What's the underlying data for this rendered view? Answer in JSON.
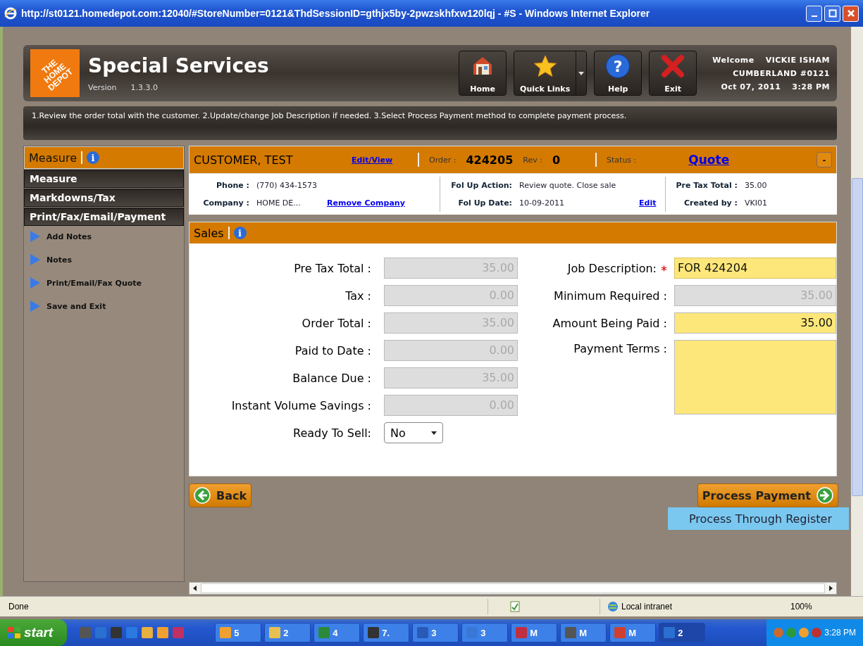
{
  "window": {
    "title": "http://st0121.homedepot.com:12040/#StoreNumber=0121&ThdSessionID=gthjx5by-2pwzskhfxw120lqj - #S - Windows Internet Explorer"
  },
  "header": {
    "logo_text": "THE HOME DEPOT",
    "app_title": "Special Services",
    "version_label": "Version",
    "version": "1.3.3.0",
    "buttons": [
      {
        "kind": "home",
        "label": "Home",
        "has_menu": false
      },
      {
        "kind": "star",
        "label": "Quick Links",
        "has_menu": true
      },
      {
        "kind": "help",
        "label": "Help",
        "glyph": "?",
        "has_menu": false
      },
      {
        "kind": "exit",
        "label": "Exit",
        "has_menu": false
      }
    ],
    "welcome": "Welcome",
    "user": "VICKIE ISHAM",
    "store": "CUMBERLAND #0121",
    "date": "Oct 07, 2011",
    "time": "3:28 PM"
  },
  "instructions": "1.Review the order total with the customer. 2.Update/change Job Description if needed. 3.Select Process Payment method to complete payment process.",
  "sidebar": {
    "title": "Measure",
    "info_icon": "i",
    "sections": [
      "Measure",
      "Markdowns/Tax",
      "Print/Fax/Email/Payment"
    ],
    "actions": [
      "Add Notes",
      "Notes",
      "Print/Email/Fax Quote",
      "Save and Exit"
    ]
  },
  "order": {
    "customer": "CUSTOMER, TEST",
    "edit_link": "Edit/View",
    "order_label": "Order :",
    "order_number": "424205",
    "rev_label": "Rev :",
    "rev": "0",
    "status_label": "Status :",
    "status": "Quote",
    "collapse": "-",
    "details": [
      {
        "label": "Phone :",
        "value": "(770) 434-1573"
      },
      {
        "label": "Fol Up Action:",
        "value": "Review quote. Close sale"
      },
      {
        "label": "Pre Tax Total :",
        "value": "35.00"
      },
      {
        "label": "Company :",
        "value": "HOME DE...",
        "link": "Remove Company"
      },
      {
        "label": "Fol Up Date:",
        "value": "10-09-2011",
        "link": "Edit"
      },
      {
        "label": "Created by :",
        "value": "VKI01"
      }
    ]
  },
  "sales": {
    "title": "Sales",
    "info_icon": "i",
    "left_fields": [
      {
        "label": "Pre Tax Total :",
        "value": "35.00",
        "editable": false
      },
      {
        "label": "Tax :",
        "value": "0.00",
        "editable": false
      },
      {
        "label": "Order Total :",
        "value": "35.00",
        "editable": false
      },
      {
        "label": "Paid to Date :",
        "value": "0.00",
        "editable": false
      },
      {
        "label": "Balance Due :",
        "value": "35.00",
        "editable": false
      },
      {
        "label": "Instant Volume Savings :",
        "value": "0.00",
        "editable": false
      }
    ],
    "ready_to_sell": {
      "label": "Ready To Sell:",
      "value": "No"
    },
    "right_fields": [
      {
        "label": "Job Description:",
        "value": "FOR 424204",
        "editable": true,
        "required": true,
        "multiline": false
      },
      {
        "label": "Minimum Required :",
        "value": "35.00",
        "editable": false,
        "required": false,
        "multiline": false
      },
      {
        "label": "Amount Being Paid :",
        "value": "35.00",
        "editable": true,
        "required": false,
        "multiline": false
      },
      {
        "label": "Payment Terms :",
        "editable": true,
        "required": false,
        "multiline": true
      }
    ]
  },
  "actions": {
    "back": "Back",
    "process": "Process Payment",
    "register": "Process Through Register"
  },
  "status_bar": {
    "text": "Done",
    "zone": "Local intranet",
    "zoom": "100%"
  },
  "taskbar": {
    "start": "start",
    "tasks": [
      {
        "kind": "outlook",
        "label": "5",
        "selected": false
      },
      {
        "kind": "folder",
        "label": "2",
        "selected": false
      },
      {
        "kind": "excel",
        "label": "4",
        "selected": false
      },
      {
        "kind": "zip",
        "label": "7.",
        "selected": false
      },
      {
        "kind": "word",
        "label": "3",
        "selected": false
      },
      {
        "kind": "app",
        "label": "3",
        "selected": false
      },
      {
        "kind": "pdf",
        "label": "M",
        "selected": false
      },
      {
        "kind": "info",
        "label": "M",
        "selected": false
      },
      {
        "kind": "mail",
        "label": "M",
        "selected": false
      },
      {
        "kind": "ie",
        "label": "2",
        "selected": true
      }
    ],
    "clock": "3:28 PM"
  }
}
